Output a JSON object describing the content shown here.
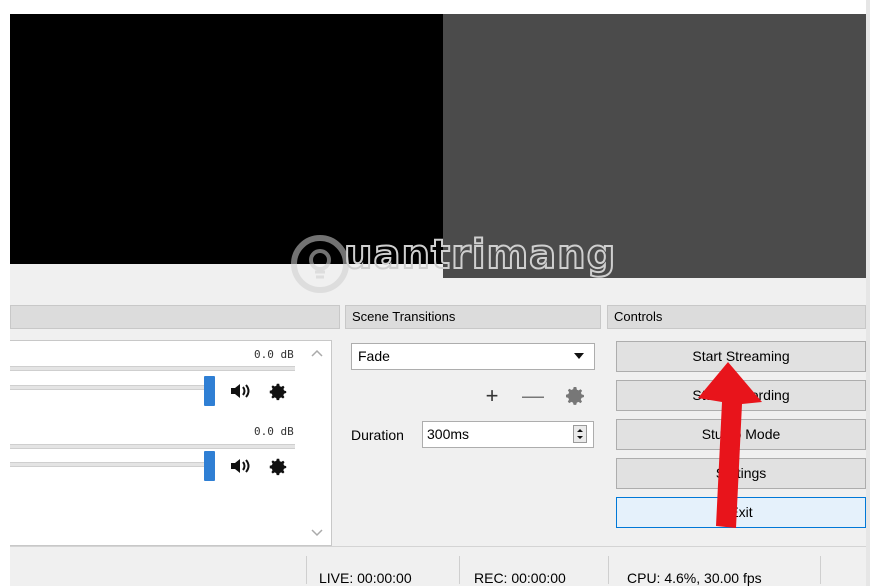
{
  "docks": {
    "scene_transitions": {
      "title": "Scene Transitions"
    },
    "controls": {
      "title": "Controls"
    }
  },
  "mixer": {
    "channels": [
      {
        "level": "0.0 dB"
      },
      {
        "level": "0.0 dB"
      }
    ]
  },
  "transitions": {
    "selected": "Fade",
    "add_symbol": "+",
    "remove_symbol": "—",
    "duration_label": "Duration",
    "duration_value": "300ms"
  },
  "controls": {
    "buttons": [
      "Start Streaming",
      "Start Recording",
      "Studio Mode",
      "Settings",
      "Exit"
    ]
  },
  "status": {
    "live": "LIVE: 00:00:00",
    "rec": "REC: 00:00:00",
    "cpu": "CPU: 4.6%, 30.00 fps"
  },
  "watermark": {
    "text": "uantrimang"
  },
  "colors": {
    "slider_accent": "#2f7fd4",
    "annotation_arrow": "#e8141b",
    "focus_border": "#0078d7"
  },
  "icons": {
    "volume": "speaker-icon",
    "settings": "gear-icon",
    "annotation": "red-arrow"
  }
}
